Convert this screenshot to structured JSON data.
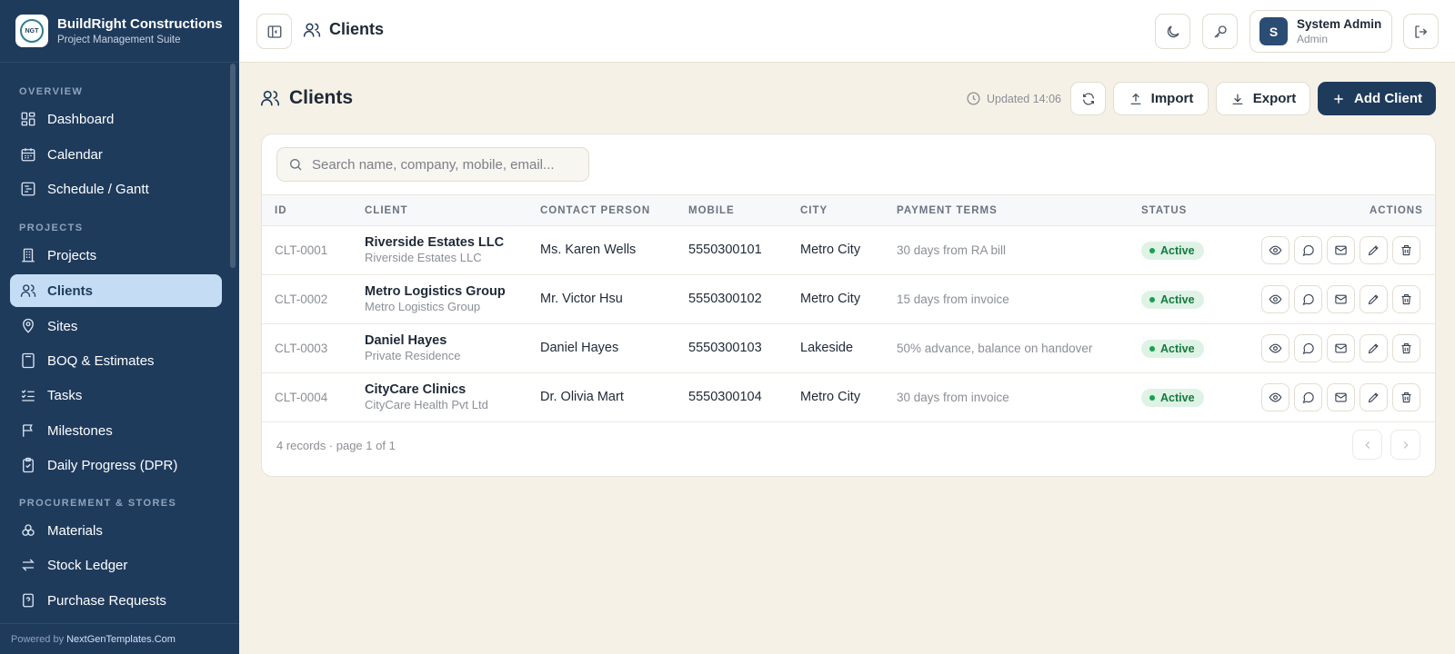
{
  "brand": {
    "title": "BuildRight Constructions",
    "subtitle": "Project Management Suite",
    "logo_text": "NGT"
  },
  "sidebar": {
    "sections": [
      "OVERVIEW",
      "PROJECTS",
      "PROCUREMENT & STORES"
    ],
    "items": [
      {
        "label": "Dashboard",
        "icon": "dashboard-icon"
      },
      {
        "label": "Calendar",
        "icon": "calendar-icon"
      },
      {
        "label": "Schedule / Gantt",
        "icon": "gantt-icon"
      },
      {
        "label": "Projects",
        "icon": "building-icon"
      },
      {
        "label": "Clients",
        "icon": "users-icon",
        "active": true
      },
      {
        "label": "Sites",
        "icon": "map-pin-icon"
      },
      {
        "label": "BOQ & Estimates",
        "icon": "calculator-icon"
      },
      {
        "label": "Tasks",
        "icon": "list-checks-icon"
      },
      {
        "label": "Milestones",
        "icon": "flag-icon"
      },
      {
        "label": "Daily Progress (DPR)",
        "icon": "clipboard-icon"
      },
      {
        "label": "Materials",
        "icon": "boxes-icon"
      },
      {
        "label": "Stock Ledger",
        "icon": "arrows-icon"
      },
      {
        "label": "Purchase Requests",
        "icon": "file-question-icon"
      }
    ],
    "footer_prefix": "Powered by",
    "footer_link": "NextGenTemplates.Com"
  },
  "topbar": {
    "title": "Clients",
    "user": {
      "initial": "S",
      "name": "System Admin",
      "role": "Admin"
    }
  },
  "page": {
    "title": "Clients",
    "updated": "Updated 14:06",
    "import_label": "Import",
    "export_label": "Export",
    "add_label": "Add Client"
  },
  "search": {
    "placeholder": "Search name, company, mobile, email..."
  },
  "table": {
    "headers": [
      "ID",
      "CLIENT",
      "CONTACT PERSON",
      "MOBILE",
      "CITY",
      "PAYMENT TERMS",
      "STATUS",
      "ACTIONS"
    ],
    "rows": [
      {
        "id": "CLT-0001",
        "name": "Riverside Estates LLC",
        "company": "Riverside Estates LLC",
        "contact": "Ms. Karen Wells",
        "mobile": "5550300101",
        "city": "Metro City",
        "terms": "30 days from RA bill",
        "status": "Active"
      },
      {
        "id": "CLT-0002",
        "name": "Metro Logistics Group",
        "company": "Metro Logistics Group",
        "contact": "Mr. Victor Hsu",
        "mobile": "5550300102",
        "city": "Metro City",
        "terms": "15 days from invoice",
        "status": "Active"
      },
      {
        "id": "CLT-0003",
        "name": "Daniel Hayes",
        "company": "Private Residence",
        "contact": "Daniel Hayes",
        "mobile": "5550300103",
        "city": "Lakeside",
        "terms": "50% advance, balance on handover",
        "status": "Active"
      },
      {
        "id": "CLT-0004",
        "name": "CityCare Clinics",
        "company": "CityCare Health Pvt Ltd",
        "contact": "Dr. Olivia Mart",
        "mobile": "5550300104",
        "city": "Metro City",
        "terms": "30 days from invoice",
        "status": "Active"
      }
    ]
  },
  "pagination": {
    "summary": "4 records · page 1 of 1"
  },
  "colors": {
    "sidebar": "#1f3b5c",
    "background": "#f6f1e6",
    "primary": "#1f3b5c",
    "active_item": "#c4ddf5",
    "status_active": "#16a34a"
  }
}
